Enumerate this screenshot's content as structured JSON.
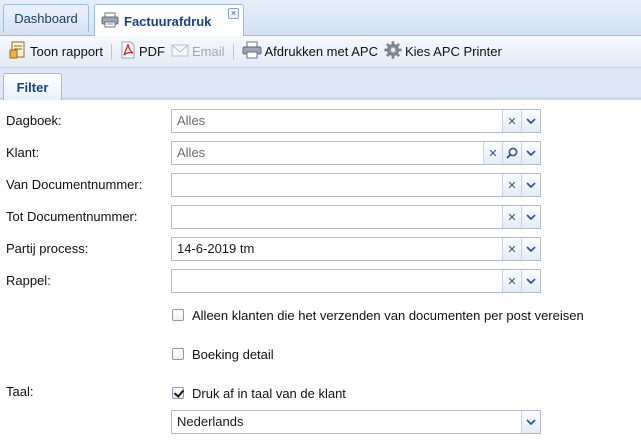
{
  "tabs": {
    "dashboard": "Dashboard",
    "active": "Factuurafdruk",
    "close_glyph": "×"
  },
  "toolbar": {
    "toon_rapport": "Toon rapport",
    "pdf": "PDF",
    "email": "Email",
    "afdrukken_apc": "Afdrukken met APC",
    "kies_apc": "Kies APC Printer"
  },
  "filter": {
    "tab_label": "Filter",
    "fields": {
      "dagboek": {
        "label": "Dagboek:",
        "value": "Alles"
      },
      "klant": {
        "label": "Klant:",
        "value": "Alles"
      },
      "van_doc": {
        "label": "Van Documentnummer:",
        "value": ""
      },
      "tot_doc": {
        "label": "Tot Documentnummer:",
        "value": ""
      },
      "partij": {
        "label": "Partij process:",
        "value": "14-6-2019 tm"
      },
      "rappel": {
        "label": "Rappel:",
        "value": ""
      }
    },
    "checks": {
      "alleen_klanten": {
        "label": "Alleen klanten die het verzenden van documenten per post vereisen",
        "checked": false
      },
      "boeking_detail": {
        "label": "Boeking detail",
        "checked": false
      },
      "druk_af_taal": {
        "label": "Druk af in taal van de klant",
        "checked": true
      }
    },
    "taal": {
      "label": "Taal:",
      "value": "Nederlands"
    }
  },
  "colors": {
    "accent": "#15428b",
    "border": "#99bbe8",
    "clear_icon": "#2c5a93"
  }
}
